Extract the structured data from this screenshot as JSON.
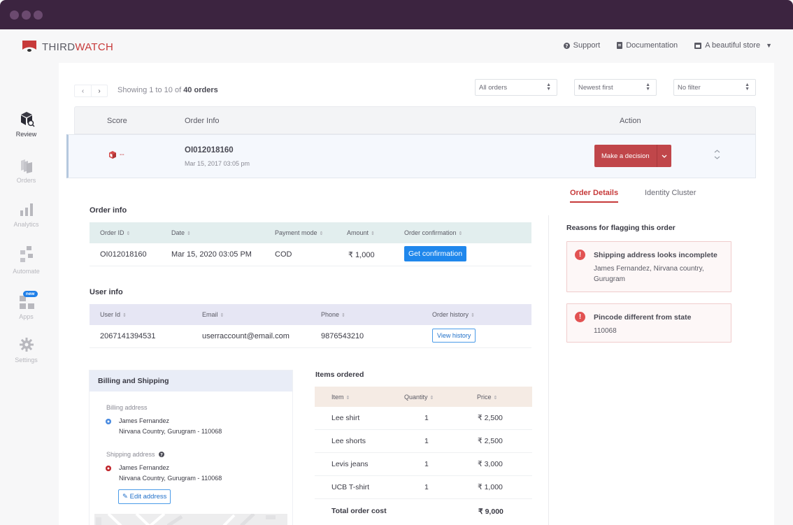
{
  "window": {
    "dots": 3
  },
  "brand": {
    "prefix": "THIRD",
    "accent": "WATCH",
    "color": "#c73a3a"
  },
  "top_links": {
    "support": "Support",
    "documentation": "Documentation",
    "store": "A beautiful store"
  },
  "sidebar": {
    "items": [
      {
        "label": "Review",
        "icon": "review-box-icon",
        "active": true
      },
      {
        "label": "Orders",
        "icon": "orders-stack-icon",
        "active": false
      },
      {
        "label": "Analytics",
        "icon": "analytics-bars-icon",
        "active": false
      },
      {
        "label": "Automate",
        "icon": "automate-boxes-icon",
        "active": false
      },
      {
        "label": "Apps",
        "icon": "apps-grid-icon",
        "active": false,
        "badge": "new"
      },
      {
        "label": "Settings",
        "icon": "gear-icon",
        "active": false
      }
    ]
  },
  "toolbar": {
    "prev": "‹",
    "next": "›",
    "showing_prefix": "Showing 1 to 10 of ",
    "showing_total": "40 orders",
    "filters": [
      {
        "selected": "All orders"
      },
      {
        "selected": "Newest first"
      },
      {
        "selected": "No filter"
      }
    ]
  },
  "order_list": {
    "headers": {
      "score": "Score",
      "order_info": "Order Info",
      "action": "Action"
    },
    "row": {
      "score": "--",
      "order_id": "OI012018160",
      "date": "Mar 15, 2017 03:05 pm",
      "action_label": "Make a decision"
    }
  },
  "detail_tabs": [
    {
      "label": "Order Details",
      "active": true
    },
    {
      "label": "Identity Cluster",
      "active": false
    }
  ],
  "order_info": {
    "title": "Order info",
    "headers": [
      "Order ID",
      "Date",
      "Payment mode",
      "Amount",
      "Order confirmation"
    ],
    "row": {
      "order_id": "OI012018160",
      "date": "Mar 15, 2020 03:05 PM",
      "payment_mode": "COD",
      "amount": "₹ 1,000",
      "confirmation_button": "Get confirmation"
    },
    "header_color": "#e2eeee"
  },
  "user_info": {
    "title": "User info",
    "headers": [
      "User Id",
      "Email",
      "Phone",
      "Order history"
    ],
    "row": {
      "user_id": "2067141394531",
      "email": "userraccount@email.com",
      "phone": "9876543210",
      "history_button": "View history"
    },
    "header_color": "#e6e6f4"
  },
  "billing_shipping": {
    "title": "Billing and Shipping",
    "billing_label": "Billing address",
    "billing_name": "James Fernandez",
    "billing_address": "Nirvana Country, Gurugram - 110068",
    "shipping_label": "Shipping address",
    "shipping_name": "James Fernandez",
    "shipping_address": "Nirvana Country, Gurugram - 110068",
    "edit_button": "Edit address"
  },
  "items_ordered": {
    "title": "Items ordered",
    "headers": [
      "Item",
      "Quantity",
      "Price"
    ],
    "rows": [
      {
        "item": "Lee shirt",
        "quantity": "1",
        "price": "₹ 2,500"
      },
      {
        "item": "Lee shorts",
        "quantity": "1",
        "price": "₹ 2,500"
      },
      {
        "item": "Levis jeans",
        "quantity": "1",
        "price": "₹ 3,000"
      },
      {
        "item": "UCB T-shirt",
        "quantity": "1",
        "price": "₹ 1,000"
      }
    ],
    "total_label": "Total order cost",
    "total_value": "₹ 9,000"
  },
  "flags": {
    "title": "Reasons for flagging this order",
    "items": [
      {
        "title": "Shipping address looks incomplete",
        "detail": "James Fernandez, Nirvana country, Gurugram"
      },
      {
        "title": "Pincode different from state",
        "detail": "110068"
      }
    ]
  }
}
